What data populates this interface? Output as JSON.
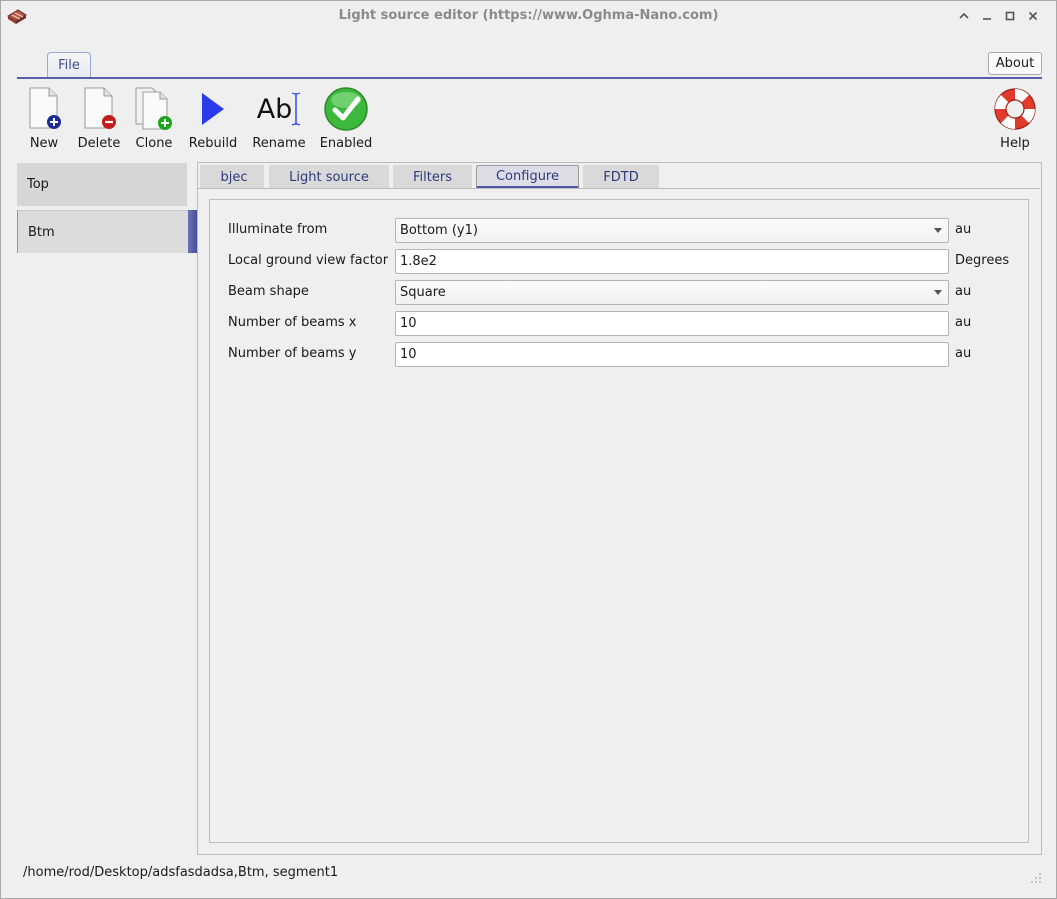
{
  "window": {
    "title": "Light source editor (https://www.Oghma-Nano.com)",
    "controls": [
      "minimize-up",
      "minimize",
      "maximize",
      "close"
    ]
  },
  "menu": {
    "file_tab": "File",
    "about": "About"
  },
  "toolbar": {
    "new": "New",
    "delete": "Delete",
    "clone": "Clone",
    "rebuild": "Rebuild",
    "rename": "Rename",
    "rename_glyph": "Ab",
    "enabled": "Enabled",
    "help": "Help"
  },
  "sidebar": {
    "items": [
      {
        "label": "Top"
      },
      {
        "label": "Btm"
      }
    ],
    "selected": "Btm"
  },
  "tabs": [
    {
      "label": "Objec",
      "visible_text": "bjec"
    },
    {
      "label": "Light source"
    },
    {
      "label": "Filters"
    },
    {
      "label": "Configure"
    },
    {
      "label": "FDTD"
    }
  ],
  "active_tab": "Configure",
  "form": {
    "rows": [
      {
        "label": "Illuminate from",
        "value": "Bottom (y1)",
        "type": "combo",
        "unit": "au"
      },
      {
        "label": "Local ground view factor",
        "value": "1.8e2",
        "type": "text",
        "unit": "Degrees"
      },
      {
        "label": "Beam shape",
        "value": "Square",
        "type": "combo",
        "unit": "au"
      },
      {
        "label": "Number of beams x",
        "value": "10",
        "type": "text",
        "unit": "au"
      },
      {
        "label": "Number of beams y",
        "value": "10",
        "type": "text",
        "unit": "au"
      }
    ]
  },
  "status_bar": {
    "path": "/home/rod/Desktop/adsfasdadsa,Btm, segment1"
  },
  "colors": {
    "accent": "#5660a8",
    "tab_text": "#2d3b7a",
    "enabled_green": "#3cb83c",
    "rebuild_blue": "#2a3bea",
    "help_red": "#e23b2e"
  }
}
